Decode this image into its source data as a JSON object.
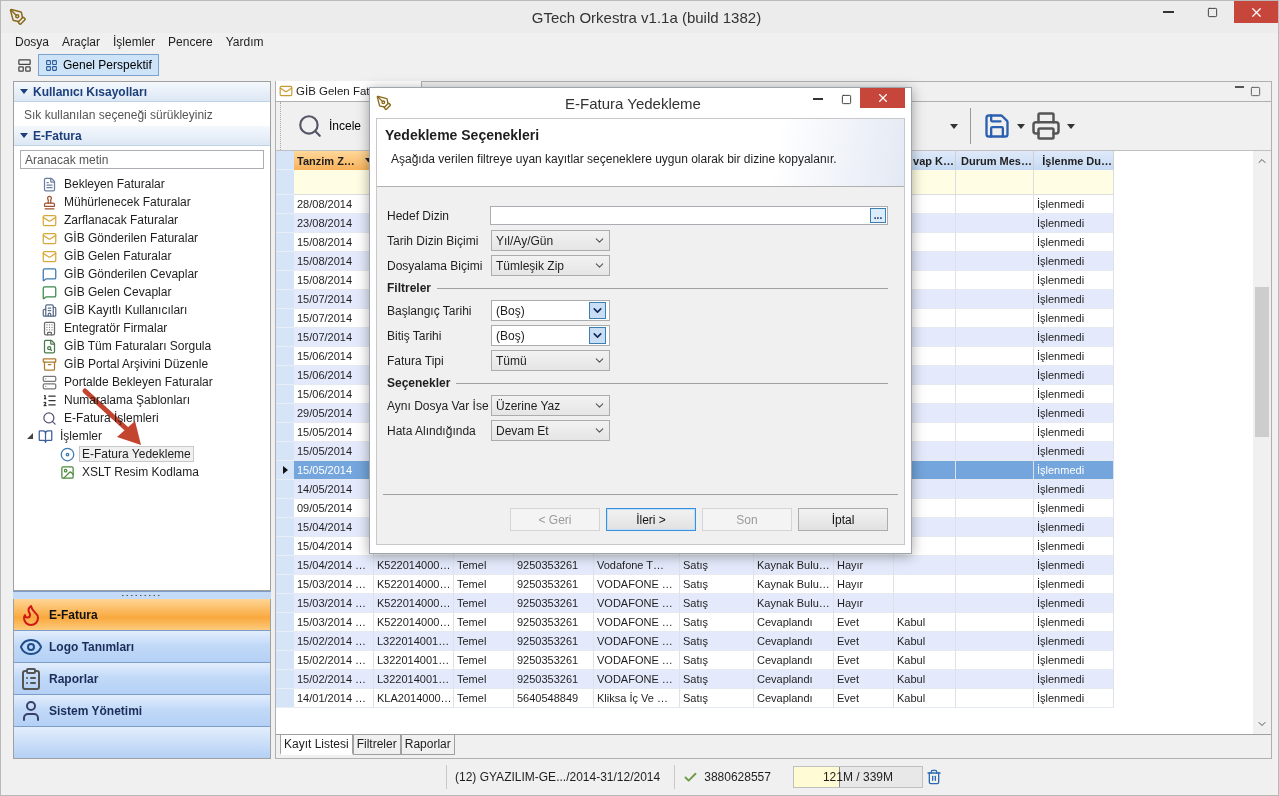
{
  "window": {
    "title": "GTech Orkestra v1.1a (build 1382)"
  },
  "menu": [
    "Dosya",
    "Araçlar",
    "İşlemler",
    "Pencere",
    "Yardım"
  ],
  "perspective": {
    "label": "Genel Perspektif",
    "selected": true
  },
  "sidebar": {
    "shortcuts": {
      "title": "Kullanıcı Kısayolları",
      "hint": "Sık kullanılan seçeneği sürükleyiniz"
    },
    "section": {
      "title": "E-Fatura",
      "search_placeholder": "Aranacak metin"
    },
    "items": [
      {
        "label": "Bekleyen Faturalar",
        "selected": false
      },
      {
        "label": "Mühürlenecek Faturalar",
        "selected": false
      },
      {
        "label": "Zarflanacak Faturalar",
        "selected": false
      },
      {
        "label": "GİB Gönderilen Faturalar",
        "selected": false
      },
      {
        "label": "GİB Gelen Faturalar",
        "selected": false
      },
      {
        "label": "GİB Gönderilen Cevaplar",
        "selected": false
      },
      {
        "label": "GİB Gelen Cevaplar",
        "selected": false
      },
      {
        "label": "GİB Kayıtlı Kullanıcıları",
        "selected": false
      },
      {
        "label": "Entegratör Firmalar",
        "selected": false
      },
      {
        "label": "GİB Tüm Faturaları Sorgula",
        "selected": false
      },
      {
        "label": "GİB Portal Arşivini Düzenle",
        "selected": false
      },
      {
        "label": "Portalde Bekleyen Faturalar",
        "selected": false
      },
      {
        "label": "Numaralama Şablonları",
        "selected": false
      },
      {
        "label": "E-Fatura İşlemleri",
        "selected": false
      },
      {
        "label": "İşlemler",
        "selected": false,
        "expanded": true,
        "children": [
          {
            "label": "E-Fatura Yedekleme",
            "selected": true
          },
          {
            "label": "XSLT Resim Kodlama",
            "selected": false
          }
        ]
      }
    ]
  },
  "nav": [
    {
      "label": "E-Fatura",
      "selected": true
    },
    {
      "label": "Logo Tanımları",
      "selected": false
    },
    {
      "label": "Raporlar",
      "selected": false
    },
    {
      "label": "Sistem Yönetimi",
      "selected": false
    }
  ],
  "document_tab": {
    "label": "GİB Gelen Fat",
    "selected": true
  },
  "toolbar": {
    "inspect": "İncele"
  },
  "table": {
    "columns": [
      {
        "label": "Tanzim Z…",
        "sorted": true
      },
      null,
      null,
      null,
      null,
      null,
      null,
      null,
      {
        "label": "vap K…",
        "sorted": false
      },
      {
        "label": "Durum Mes…",
        "sorted": false
      },
      {
        "label": "İşlenme Du…",
        "sorted": false
      }
    ],
    "rows": [
      {
        "selected": false,
        "cells": [
          "28/08/2014",
          null,
          null,
          null,
          null,
          null,
          null,
          null,
          null,
          null,
          "İşlenmedi"
        ]
      },
      {
        "selected": false,
        "cells": [
          "23/08/2014",
          null,
          null,
          null,
          null,
          null,
          null,
          null,
          null,
          null,
          "İşlenmedi"
        ]
      },
      {
        "selected": false,
        "cells": [
          "15/08/2014",
          null,
          null,
          null,
          null,
          null,
          null,
          null,
          null,
          null,
          "İşlenmedi"
        ]
      },
      {
        "selected": false,
        "cells": [
          "15/08/2014",
          null,
          null,
          null,
          null,
          null,
          null,
          null,
          null,
          null,
          "İşlenmedi"
        ]
      },
      {
        "selected": false,
        "cells": [
          "15/08/2014",
          null,
          null,
          null,
          null,
          null,
          null,
          null,
          null,
          null,
          "İşlenmedi"
        ]
      },
      {
        "selected": false,
        "cells": [
          "15/07/2014",
          null,
          null,
          null,
          null,
          null,
          null,
          null,
          null,
          null,
          "İşlenmedi"
        ]
      },
      {
        "selected": false,
        "cells": [
          "15/07/2014",
          null,
          null,
          null,
          null,
          null,
          null,
          null,
          null,
          null,
          "İşlenmedi"
        ]
      },
      {
        "selected": false,
        "cells": [
          "15/07/2014",
          null,
          null,
          null,
          null,
          null,
          null,
          null,
          null,
          null,
          "İşlenmedi"
        ]
      },
      {
        "selected": false,
        "cells": [
          "15/06/2014",
          null,
          null,
          null,
          null,
          null,
          null,
          null,
          null,
          null,
          "İşlenmedi"
        ]
      },
      {
        "selected": false,
        "cells": [
          "15/06/2014",
          null,
          null,
          null,
          null,
          null,
          null,
          null,
          null,
          null,
          "İşlenmedi"
        ]
      },
      {
        "selected": false,
        "cells": [
          "15/06/2014",
          null,
          null,
          null,
          null,
          null,
          null,
          null,
          null,
          null,
          "İşlenmedi"
        ]
      },
      {
        "selected": false,
        "cells": [
          "29/05/2014",
          null,
          null,
          null,
          null,
          null,
          null,
          null,
          null,
          null,
          "İşlenmedi"
        ]
      },
      {
        "selected": false,
        "cells": [
          "15/05/2014",
          null,
          null,
          null,
          null,
          null,
          null,
          null,
          null,
          null,
          "İşlenmedi"
        ]
      },
      {
        "selected": false,
        "cells": [
          "15/05/2014",
          null,
          null,
          null,
          null,
          null,
          null,
          null,
          null,
          null,
          "İşlenmedi"
        ]
      },
      {
        "selected": true,
        "cells": [
          "15/05/2014",
          null,
          null,
          null,
          null,
          null,
          null,
          null,
          null,
          null,
          "İşlenmedi"
        ]
      },
      {
        "selected": false,
        "cells": [
          "14/05/2014",
          null,
          null,
          null,
          null,
          null,
          null,
          null,
          null,
          null,
          "İşlenmedi"
        ]
      },
      {
        "selected": false,
        "cells": [
          "09/05/2014",
          null,
          null,
          null,
          null,
          null,
          null,
          null,
          null,
          null,
          "İşlenmedi"
        ]
      },
      {
        "selected": false,
        "cells": [
          "15/04/2014",
          null,
          null,
          null,
          null,
          null,
          null,
          null,
          null,
          null,
          "İşlenmedi"
        ]
      },
      {
        "selected": false,
        "cells": [
          "15/04/2014",
          null,
          null,
          null,
          null,
          null,
          null,
          null,
          null,
          null,
          "İşlenmedi"
        ]
      },
      {
        "selected": false,
        "cells": [
          "15/04/2014 …",
          "K522014000…",
          "Temel",
          "9250353261",
          "Vodafone T…",
          "Satış",
          "Kaynak Bulu…",
          "Hayır",
          null,
          null,
          "İşlenmedi"
        ]
      },
      {
        "selected": false,
        "cells": [
          "15/03/2014 …",
          "K522014000…",
          "Temel",
          "9250353261",
          "VODAFONE …",
          "Satış",
          "Kaynak Bulu…",
          "Hayır",
          null,
          null,
          "İşlenmedi"
        ]
      },
      {
        "selected": false,
        "cells": [
          "15/03/2014 …",
          "K522014000…",
          "Temel",
          "9250353261",
          "VODAFONE …",
          "Satış",
          "Kaynak Bulu…",
          "Hayır",
          null,
          null,
          "İşlenmedi"
        ]
      },
      {
        "selected": false,
        "cells": [
          "15/03/2014 …",
          "K522014000…",
          "Temel",
          "9250353261",
          "VODAFONE …",
          "Satış",
          "Cevaplandı",
          "Evet",
          "Kabul",
          null,
          "İşlenmedi"
        ]
      },
      {
        "selected": false,
        "cells": [
          "15/02/2014 …",
          "L322014001…",
          "Temel",
          "9250353261",
          "VODAFONE …",
          "Satış",
          "Cevaplandı",
          "Evet",
          "Kabul",
          null,
          "İşlenmedi"
        ]
      },
      {
        "selected": false,
        "cells": [
          "15/02/2014 …",
          "L322014001…",
          "Temel",
          "9250353261",
          "VODAFONE …",
          "Satış",
          "Cevaplandı",
          "Evet",
          "Kabul",
          null,
          "İşlenmedi"
        ]
      },
      {
        "selected": false,
        "cells": [
          "15/02/2014 …",
          "L322014001…",
          "Temel",
          "9250353261",
          "VODAFONE …",
          "Satış",
          "Cevaplandı",
          "Evet",
          "Kabul",
          null,
          "İşlenmedi"
        ]
      },
      {
        "selected": false,
        "cells": [
          "14/01/2014 …",
          "KLA2014000…",
          "Temel",
          "5640548849",
          "Kliksa İç Ve …",
          "Satış",
          "Cevaplandı",
          "Evet",
          "Kabul",
          null,
          "İşlenmedi"
        ]
      }
    ]
  },
  "bottom_tabs": [
    {
      "label": "Kayıt Listesi",
      "selected": true
    },
    {
      "label": "Filtreler",
      "selected": false
    },
    {
      "label": "Raporlar",
      "selected": false
    }
  ],
  "status_bar": {
    "filter": "(12) GYAZILIM-GE.../2014-31/12/2014",
    "tax_id": "3880628557",
    "memory": {
      "reading": "121M / 339M",
      "level": 0.36
    }
  },
  "dialog": {
    "title": "E-Fatura Yedekleme",
    "heading": "Yedekleme Seçenekleri",
    "description": "Aşağıda verilen filtreye uyan kayıtlar seçeneklere uygun olarak bir dizine kopyalanır.",
    "fields": [
      {
        "kind": "path",
        "label": "Hedef Dizin",
        "button": "..."
      },
      {
        "kind": "select",
        "label": "Tarih Dizin Biçimi",
        "value": "Yıl/Ay/Gün"
      },
      {
        "kind": "select",
        "label": "Dosyalama Biçimi",
        "value": "Tümleşik Zip"
      },
      {
        "kind": "section",
        "label": "Filtreler"
      },
      {
        "kind": "date",
        "label": "Başlangıç Tarihi",
        "value": "(Boş)"
      },
      {
        "kind": "date",
        "label": "Bitiş Tarihi",
        "value": "(Boş)"
      },
      {
        "kind": "select",
        "label": "Fatura Tipi",
        "value": "Tümü"
      },
      {
        "kind": "section",
        "label": "Seçenekler"
      },
      {
        "kind": "select",
        "label": "Aynı Dosya Var İse",
        "value": "Üzerine Yaz"
      },
      {
        "kind": "select",
        "label": "Hata Alındığında",
        "value": "Devam Et"
      }
    ],
    "buttons": [
      {
        "label": "< Geri",
        "disabled": true,
        "focused": false
      },
      {
        "label": "İleri >",
        "disabled": false,
        "focused": true
      },
      {
        "label": "Son",
        "disabled": true,
        "focused": false
      },
      {
        "label": "İptal",
        "disabled": false,
        "focused": false
      }
    ]
  }
}
